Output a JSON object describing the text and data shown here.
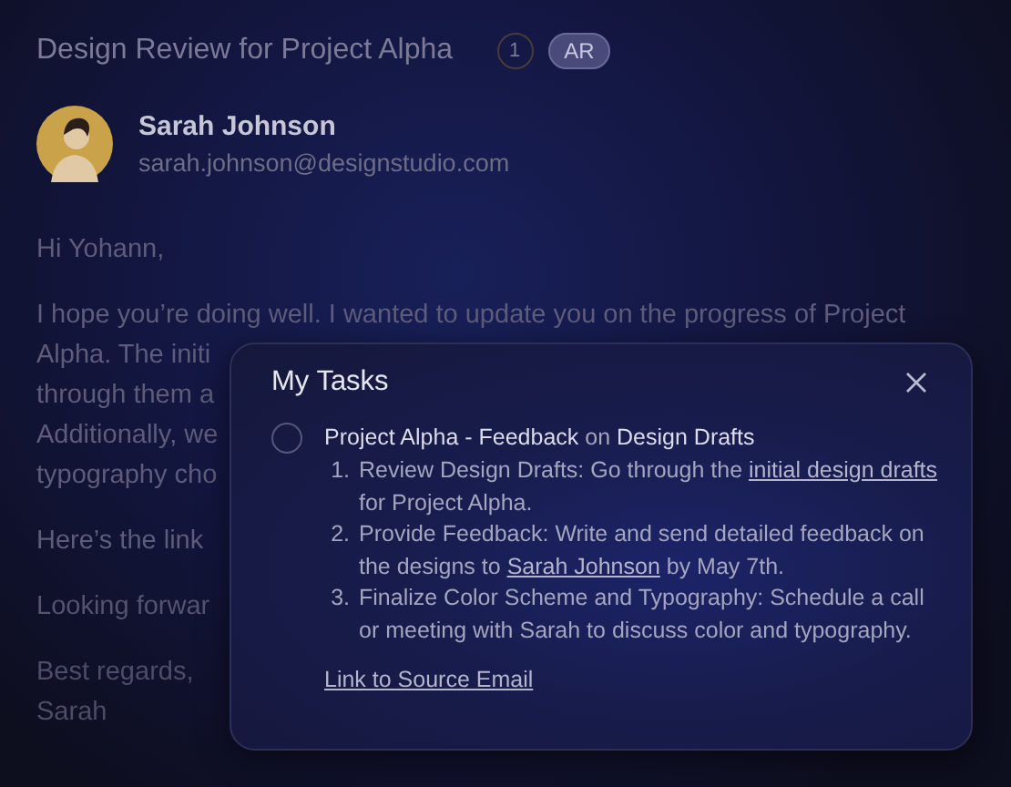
{
  "email": {
    "subject": "Design Review for Project Alpha",
    "count": "1",
    "initials": "AR",
    "sender": {
      "name": "Sarah Johnson",
      "address": "sarah.johnson@designstudio.com"
    },
    "paragraphs": [
      [
        "Hi Yohann,"
      ],
      [
        "I hope you’re doing well. I wanted to update you on the progress of Project",
        "Alpha. The initi",
        "through them a",
        "Additionally, we",
        "typography cho"
      ],
      [
        "Here’s the link"
      ],
      [
        "Looking forwar"
      ],
      [
        "Best regards,",
        "Sarah"
      ]
    ]
  },
  "tasks_panel": {
    "title": "My Tasks",
    "tasks": [
      {
        "title": "**Project Alpha - Feedback** on **Design Drafts**",
        "checked": false,
        "steps": [
          {
            "number": "1.",
            "parts": [
              {
                "text": "Review Design Drafts: Go through the "
              },
              {
                "text": "initial design drafts",
                "link": true
              },
              {
                "text": " for Project Alpha."
              }
            ]
          },
          {
            "number": "2.",
            "parts": [
              {
                "text": "Provide Feedback: Write and send detailed feedback on the designs to "
              },
              {
                "text": "Sarah Johnson",
                "link": true
              },
              {
                "text": " by May 7th."
              }
            ]
          },
          {
            "number": "3.",
            "parts": [
              {
                "text": "Finalize Color Scheme and Typography: Schedule a call or meeting with Sarah to discuss color and typography."
              }
            ]
          }
        ]
      }
    ],
    "source_link": "Link to Source Email"
  }
}
